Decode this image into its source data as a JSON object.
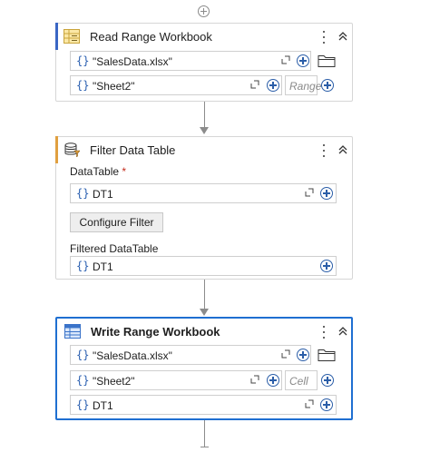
{
  "activities": [
    {
      "title": "Read Range Workbook",
      "fields": [
        {
          "value": "\"SalesData.xlsx\""
        },
        {
          "value": "\"Sheet2\"",
          "placeholder": "Range"
        }
      ]
    },
    {
      "title": "Filter Data Table",
      "datatable_label": "DataTable",
      "required_mark": "*",
      "datatable_value": "DT1",
      "configure_button": "Configure Filter",
      "filtered_label": "Filtered DataTable",
      "filtered_value": "DT1"
    },
    {
      "title": "Write Range Workbook",
      "fields": [
        {
          "value": "\"SalesData.xlsx\""
        },
        {
          "value": "\"Sheet2\"",
          "placeholder": "Cell"
        },
        {
          "value": "DT1"
        }
      ]
    }
  ],
  "icons": {
    "brace": "{}",
    "kebab": "more-vertical-icon",
    "collapse": "chevron-double-up-icon",
    "expand": "expand-editor-icon",
    "plus": "plus-circle-icon",
    "folder": "folder-icon"
  },
  "colors": {
    "read_accent": "#3a66c4",
    "filter_accent": "#e0a040",
    "selection": "#1f6fd1",
    "connector": "#8c8c8c"
  }
}
